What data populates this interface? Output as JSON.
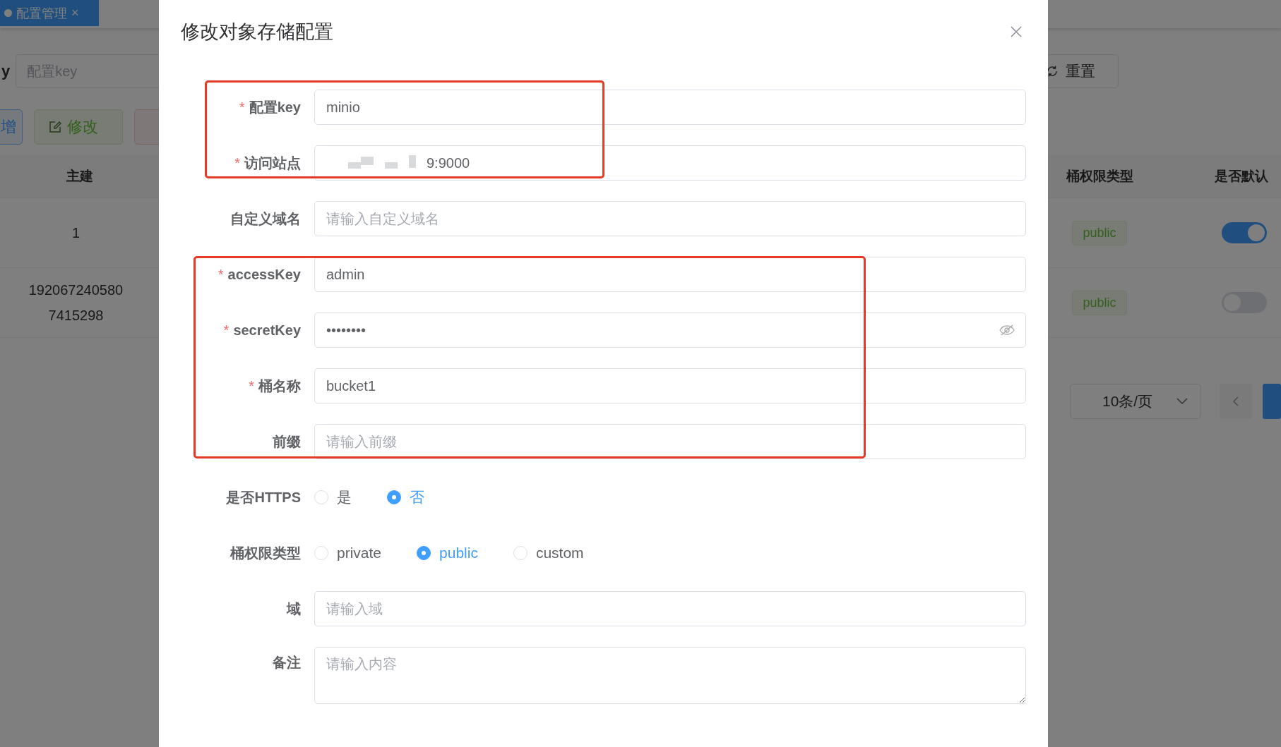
{
  "background": {
    "tab": {
      "label": "配置管理",
      "close": "×"
    },
    "search": {
      "label_fragment": "y",
      "placeholder": "配置key",
      "reset_button": "重置"
    },
    "toolbar": [
      {
        "label": "增",
        "kind": "primary"
      },
      {
        "label": "修改",
        "kind": "success"
      },
      {
        "kind": "danger"
      }
    ],
    "table": {
      "columns_left": [
        "主建"
      ],
      "columns_right": [
        "桶权限类型",
        "是否默认"
      ],
      "rows": [
        {
          "id": "1",
          "acl": "public",
          "default": true
        },
        {
          "id": "1920672405807415298",
          "acl": "public",
          "default": false
        }
      ]
    },
    "pagination": {
      "page_size": "10条/页"
    }
  },
  "dialog": {
    "title": "修改对象存储配置",
    "fields": [
      {
        "kind": "input",
        "label": "配置key",
        "required_mark": "*",
        "value": "minio"
      },
      {
        "kind": "input",
        "label": "访问站点",
        "required_mark": "*",
        "value": "9:9000",
        "redacted": true
      },
      {
        "kind": "input",
        "label": "自定义域名",
        "placeholder": "请输入自定义域名"
      },
      {
        "kind": "input",
        "label": "accessKey",
        "required_mark": "*",
        "value": "admin"
      },
      {
        "kind": "password",
        "label": "secretKey",
        "required_mark": "*",
        "value": "••••••••"
      },
      {
        "kind": "input",
        "label": "桶名称",
        "required_mark": "*",
        "value": "bucket1"
      },
      {
        "kind": "input",
        "label": "前缀",
        "placeholder": "请输入前缀"
      },
      {
        "kind": "radio",
        "label": "是否HTTPS",
        "options": [
          {
            "label": "是",
            "selected": false
          },
          {
            "label": "否",
            "selected": true
          }
        ]
      },
      {
        "kind": "radio",
        "label": "桶权限类型",
        "options": [
          {
            "label": "private",
            "selected": false
          },
          {
            "label": "public",
            "selected": true
          },
          {
            "label": "custom",
            "selected": false
          }
        ]
      },
      {
        "kind": "input",
        "label": "域",
        "placeholder": "请输入域"
      },
      {
        "kind": "textarea",
        "label": "备注",
        "placeholder": "请输入内容"
      }
    ]
  }
}
